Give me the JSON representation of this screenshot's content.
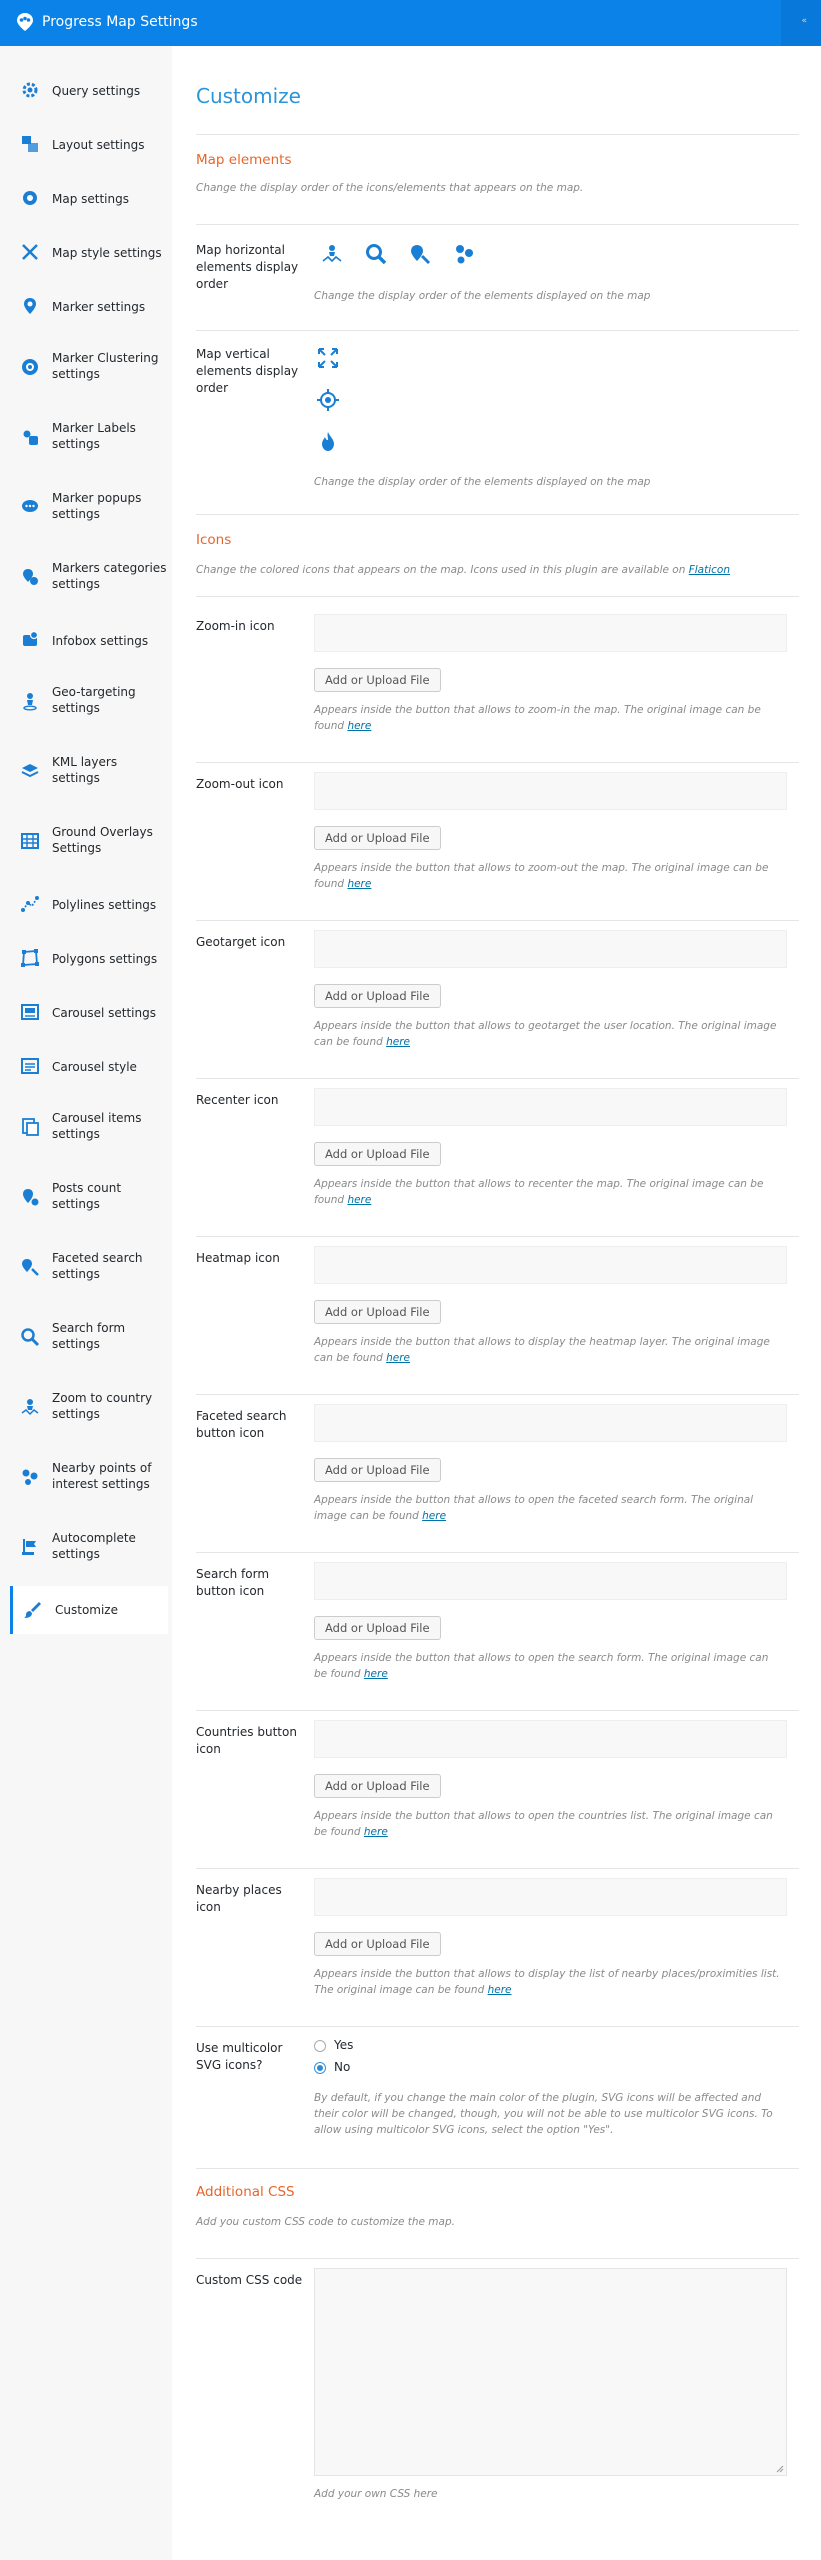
{
  "header": {
    "title": "Progress Map Settings",
    "corner_glyph": "«"
  },
  "sidebar": {
    "items": [
      {
        "label": "Query settings",
        "icon": "gear-icon"
      },
      {
        "label": "Layout settings",
        "icon": "layout-icon"
      },
      {
        "label": "Map settings",
        "icon": "gear-map-icon"
      },
      {
        "label": "Map style settings",
        "icon": "style-icon"
      },
      {
        "label": "Marker settings",
        "icon": "marker-icon"
      },
      {
        "label": "Marker Clustering settings",
        "icon": "cluster-icon"
      },
      {
        "label": "Marker Labels settings",
        "icon": "label-icon"
      },
      {
        "label": "Marker popups settings",
        "icon": "popup-icon"
      },
      {
        "label": "Markers categories settings",
        "icon": "categories-icon"
      },
      {
        "label": "Infobox settings",
        "icon": "infobox-icon"
      },
      {
        "label": "Geo-targeting settings",
        "icon": "geotarget-icon"
      },
      {
        "label": "KML layers settings",
        "icon": "layers-icon"
      },
      {
        "label": "Ground Overlays Settings",
        "icon": "overlay-icon"
      },
      {
        "label": "Polylines settings",
        "icon": "polyline-icon"
      },
      {
        "label": "Polygons settings",
        "icon": "polygon-icon"
      },
      {
        "label": "Carousel settings",
        "icon": "carousel-icon"
      },
      {
        "label": "Carousel style",
        "icon": "carousel-style-icon"
      },
      {
        "label": "Carousel items settings",
        "icon": "carousel-items-icon"
      },
      {
        "label": "Posts count settings",
        "icon": "posts-count-icon"
      },
      {
        "label": "Faceted search settings",
        "icon": "faceted-search-icon"
      },
      {
        "label": "Search form settings",
        "icon": "search-icon"
      },
      {
        "label": "Zoom to country settings",
        "icon": "zoom-country-icon"
      },
      {
        "label": "Nearby points of interest settings",
        "icon": "nearby-icon"
      },
      {
        "label": "Autocomplete settings",
        "icon": "autocomplete-icon"
      },
      {
        "label": "Customize",
        "icon": "brush-icon",
        "active": true
      }
    ]
  },
  "main": {
    "heading": "Customize",
    "map_elements": {
      "title": "Map elements",
      "desc": "Change the display order of the icons/elements that appears on the map.",
      "horizontal": {
        "label": "Map horizontal elements display order",
        "desc": "Change the display order of the elements displayed on the map"
      },
      "vertical": {
        "label": "Map vertical elements display order",
        "desc": "Change the display order of the elements displayed on the map"
      }
    },
    "icons": {
      "title": "Icons",
      "desc_prefix": "Change the colored icons that appears on the map. Icons used in this plugin are available on ",
      "desc_link": "Flaticon",
      "button_label": "Add or Upload File",
      "link_text": "here",
      "rows": [
        {
          "label": "Zoom-in icon",
          "desc": "Appears inside the button that allows to zoom-in the map. The original image can be found "
        },
        {
          "label": "Zoom-out icon",
          "desc": "Appears inside the button that allows to zoom-out the map. The original image can be found "
        },
        {
          "label": "Geotarget icon",
          "desc": "Appears inside the button that allows to geotarget the user location. The original image can be found "
        },
        {
          "label": "Recenter icon",
          "desc": "Appears inside the button that allows to recenter the map. The original image can be found "
        },
        {
          "label": "Heatmap icon",
          "desc": "Appears inside the button that allows to display the heatmap layer. The original image can be found "
        },
        {
          "label": "Faceted search button icon",
          "desc": "Appears inside the button that allows to open the faceted search form. The original image can be found "
        },
        {
          "label": "Search form button icon",
          "desc": "Appears inside the button that allows to open the search form. The original image can be found "
        },
        {
          "label": "Countries button icon",
          "desc": "Appears inside the button that allows to open the countries list. The original image can be found "
        },
        {
          "label": "Nearby places icon",
          "desc": "Appears inside the button that allows to display the list of nearby places/proximities list. The original image can be found "
        }
      ]
    },
    "multicolor": {
      "label": "Use multicolor SVG icons?",
      "yes": "Yes",
      "no": "No",
      "selected": "No",
      "desc": "By default, if you change the main color of the plugin, SVG icons will be affected and their color will be changed, though, you will not be able to use multicolor SVG icons. To allow using multicolor SVG icons, select the option \"Yes\"."
    },
    "additional_css": {
      "title": "Additional CSS",
      "desc": "Add you custom CSS code to customize the map.",
      "label": "Custom CSS code",
      "help": "Add your own CSS here"
    }
  },
  "colors": {
    "accent": "#0a82e8",
    "section_title": "#e8652a",
    "heading": "#2a95d8"
  }
}
